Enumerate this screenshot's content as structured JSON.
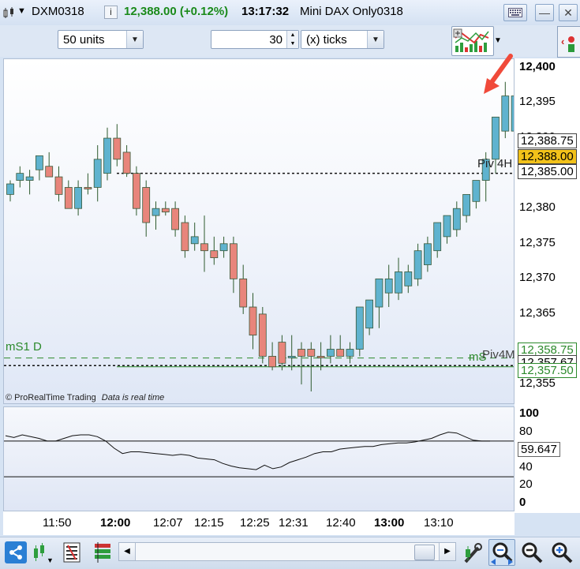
{
  "titlebar": {
    "symbol": "DXM0318",
    "info_glyph": "i",
    "price_change": "12,388.00 (+0.12%)",
    "time": "13:17:32",
    "name": "Mini DAX Only0318",
    "keyboard_icon": "keyboard-icon",
    "minimize": "—",
    "close": "✕"
  },
  "toolbar": {
    "units_value": "50 units",
    "ticks_value": "30",
    "ticks_unit": "(x) ticks"
  },
  "chart": {
    "copyright": "© ProRealTime Trading",
    "realtime_note": "Data is real time",
    "level_labels": {
      "piv4h": "Piv 4H",
      "ms1d": "mS1 D",
      "ms_right": "mS",
      "piv4m": "Piv4M"
    },
    "price_tags": {
      "tag1": "12,388.75",
      "current": "12,388.00",
      "piv4h": "12,385.00",
      "tag4": "12,358.75",
      "tag5": "12,357.67",
      "tag6": "12,357.50"
    },
    "indicator_value": "59.647",
    "colors": {
      "up": "#5fb3cf",
      "down": "#e8857b",
      "current_tag": "#f2c21a",
      "support_green": "#2c8a2c"
    }
  },
  "chart_data": {
    "type": "candlestick",
    "price_axis": {
      "ticks": [
        12355,
        12360,
        12365,
        12370,
        12375,
        12380,
        12385,
        12390,
        12395,
        12400
      ],
      "tick_labels": [
        "12,355",
        "12,360",
        "12,365",
        "12,370",
        "12,375",
        "12,380",
        "12,385",
        "12,390",
        "12,395",
        "12,400"
      ],
      "ylim": [
        12354,
        12401
      ]
    },
    "time_axis": [
      "11:50",
      "12:00",
      "12:07",
      "12:15",
      "12:25",
      "12:31",
      "12:40",
      "13:00",
      "13:10"
    ],
    "time_axis_bold": [
      false,
      true,
      false,
      false,
      false,
      false,
      false,
      true,
      false
    ],
    "levels": [
      {
        "name": "Piv 4H",
        "value": 12385.0,
        "style": "dotted"
      },
      {
        "name": "mS1 D",
        "value": 12358.75,
        "style": "dashed"
      },
      {
        "name": "Piv4M",
        "value": 12357.5,
        "style": "solid"
      },
      {
        "name": "",
        "value": 12357.67,
        "style": "dotted"
      }
    ],
    "candles": [
      [
        12382,
        12384,
        12381,
        12383.5
      ],
      [
        12384,
        12386,
        12383,
        12385
      ],
      [
        12384,
        12385.5,
        12382,
        12384.5
      ],
      [
        12385.5,
        12387,
        12384,
        12387.5
      ],
      [
        12386,
        12388,
        12384.5,
        12384.5
      ],
      [
        12384.5,
        12386,
        12381,
        12382
      ],
      [
        12383,
        12384,
        12380,
        12380
      ],
      [
        12380,
        12384,
        12379,
        12383
      ],
      [
        12383,
        12385,
        12382,
        12383
      ],
      [
        12383,
        12389,
        12381,
        12387
      ],
      [
        12385,
        12391.5,
        12384,
        12390
      ],
      [
        12390,
        12392,
        12386,
        12387
      ],
      [
        12388,
        12389,
        12384.5,
        12385
      ],
      [
        12385,
        12386,
        12379,
        12380
      ],
      [
        12383,
        12384,
        12376,
        12378
      ],
      [
        12379,
        12381,
        12377,
        12380
      ],
      [
        12380,
        12381,
        12379,
        12379.5
      ],
      [
        12380,
        12381,
        12376,
        12377
      ],
      [
        12378,
        12379,
        12373,
        12374
      ],
      [
        12376,
        12378,
        12374,
        12375
      ],
      [
        12375,
        12379,
        12371,
        12374
      ],
      [
        12374,
        12376,
        12372,
        12373
      ],
      [
        12374,
        12376,
        12373,
        12375
      ],
      [
        12375,
        12376,
        12368,
        12370
      ],
      [
        12370,
        12372,
        12365,
        12366
      ],
      [
        12366,
        12368,
        12360,
        12362
      ],
      [
        12365,
        12366,
        12358,
        12359
      ],
      [
        12359,
        12361,
        12357,
        12357.5
      ],
      [
        12361,
        12362,
        12357,
        12358
      ],
      [
        12359,
        12362,
        12357,
        12359
      ],
      [
        12360,
        12361,
        12355,
        12359
      ],
      [
        12360,
        12361,
        12354,
        12359
      ],
      [
        12359,
        12361,
        12357,
        12359
      ],
      [
        12359,
        12362,
        12358,
        12360
      ],
      [
        12360,
        12362,
        12359,
        12359
      ],
      [
        12359,
        12361,
        12358,
        12360
      ],
      [
        12360,
        12365,
        12359,
        12366
      ],
      [
        12363,
        12367,
        12362,
        12367
      ],
      [
        12366,
        12370,
        12363,
        12370
      ],
      [
        12368,
        12372,
        12366,
        12370
      ],
      [
        12368,
        12373,
        12367,
        12371
      ],
      [
        12369,
        12372,
        12368,
        12371
      ],
      [
        12370,
        12375,
        12369,
        12374
      ],
      [
        12372,
        12376,
        12371,
        12375
      ],
      [
        12374,
        12378,
        12373,
        12378
      ],
      [
        12376,
        12379,
        12375,
        12379
      ],
      [
        12377,
        12381,
        12376,
        12380
      ],
      [
        12379,
        12382,
        12378,
        12382
      ],
      [
        12381,
        12384,
        12380,
        12384
      ],
      [
        12384,
        12388,
        12381,
        12387
      ],
      [
        12387,
        12393,
        12385,
        12393
      ],
      [
        12391,
        12398,
        12390,
        12396
      ],
      [
        12396,
        12397,
        12392,
        12391
      ],
      [
        12394,
        12395,
        12391,
        12394
      ],
      [
        12393.5,
        12396,
        12392,
        12393.5
      ],
      [
        12393.5,
        12394,
        12388,
        12390
      ],
      [
        12390.5,
        12392,
        12387,
        12388
      ]
    ],
    "candle_up": [
      true,
      true,
      true,
      true,
      false,
      false,
      false,
      true,
      false,
      true,
      true,
      false,
      false,
      false,
      false,
      true,
      false,
      false,
      false,
      true,
      false,
      false,
      true,
      false,
      false,
      false,
      false,
      false,
      false,
      true,
      false,
      false,
      false,
      true,
      false,
      true,
      true,
      true,
      true,
      true,
      true,
      true,
      true,
      true,
      true,
      true,
      true,
      true,
      true,
      true,
      true,
      true,
      true,
      false,
      true,
      false,
      false
    ],
    "indicator": {
      "name": "",
      "ticks": [
        0,
        20,
        40,
        60,
        80,
        100
      ],
      "ylim": [
        0,
        100
      ],
      "upper_line": 70,
      "lower_line": 30,
      "last_value": 59.647,
      "values": [
        76,
        74,
        77,
        75,
        73,
        70,
        70,
        73,
        76,
        77,
        77,
        75,
        70,
        62,
        56,
        58,
        58,
        57,
        56,
        55,
        54,
        55,
        54,
        51,
        50,
        49,
        45,
        42,
        40,
        39,
        38,
        43,
        39,
        41,
        46,
        49,
        52,
        56,
        58,
        58,
        61,
        62,
        63,
        64,
        64,
        66,
        67,
        68,
        68,
        69,
        71,
        73,
        77,
        80,
        79,
        75,
        71,
        70,
        70
      ]
    }
  },
  "statusbar": {
    "share_icon": "share-icon",
    "candle_menu_icon": "candlestick-type-icon",
    "list_icon": "list-icon",
    "indicators_icon": "indicators-icon",
    "tools_icon": "tools-icon",
    "zoom_fit_icon": "zoom-fit-icon",
    "zoom_out_icon": "zoom-out-icon",
    "zoom_in_icon": "zoom-in-icon"
  }
}
